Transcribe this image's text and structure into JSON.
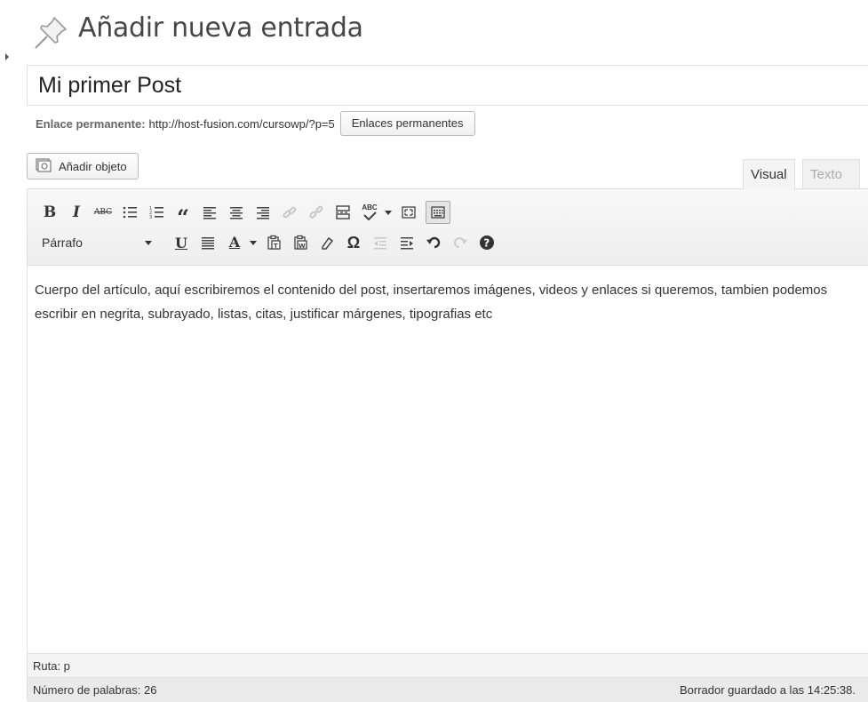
{
  "page": {
    "title": "Añadir nueva entrada",
    "icon": "pushpin-icon"
  },
  "post": {
    "title_value": "Mi primer Post"
  },
  "permalink": {
    "label": "Enlace permanente:",
    "url": "http://host-fusion.com/cursowp/?p=5",
    "button_label": "Enlaces permanentes"
  },
  "media": {
    "add_label": "Añadir objeto",
    "icon": "media-icon"
  },
  "tabs": [
    {
      "label": "Visual",
      "active": true
    },
    {
      "label": "Texto",
      "active": false
    }
  ],
  "toolbar": {
    "format_value": "Párrafo",
    "row1": [
      "bold-icon",
      "italic-icon",
      "strikethrough-icon",
      "bullet-list-icon",
      "numbered-list-icon",
      "blockquote-icon",
      "align-left-icon",
      "align-center-icon",
      "align-right-icon",
      "insert-link-icon",
      "remove-link-icon",
      "read-more-icon",
      "spellcheck-icon",
      "fullscreen-icon",
      "kitchen-sink-icon"
    ],
    "row2": [
      "format-select",
      "underline-icon",
      "justify-icon",
      "text-color-icon",
      "paste-text-icon",
      "paste-word-icon",
      "clear-formatting-icon",
      "special-character-icon",
      "outdent-icon",
      "indent-icon",
      "undo-icon",
      "redo-icon",
      "help-icon"
    ],
    "bold_glyph": "B",
    "italic_glyph": "I",
    "strike_glyph": "ABC",
    "underline_glyph": "U",
    "text_color_glyph": "A",
    "omega_glyph": "Ω",
    "quote_glyph": "“",
    "spell_glyph": "ABC"
  },
  "editor": {
    "content": "Cuerpo del artículo, aquí escribiremos el contenido del post, insertaremos imágenes, videos y enlaces si queremos, tambien podemos escribir en negrita, subrayado, listas, citas, justificar márgenes, tipografias etc"
  },
  "footer": {
    "path": "Ruta: p",
    "word_count": "Número de palabras: 26",
    "draft_saved": "Borrador guardado a las 14:25:38."
  },
  "colors": {
    "border": "#dfdfdf",
    "toolbar_bg": "#eeeeee",
    "status_bg": "#eaeaea",
    "text_color_bar": "#333333"
  }
}
